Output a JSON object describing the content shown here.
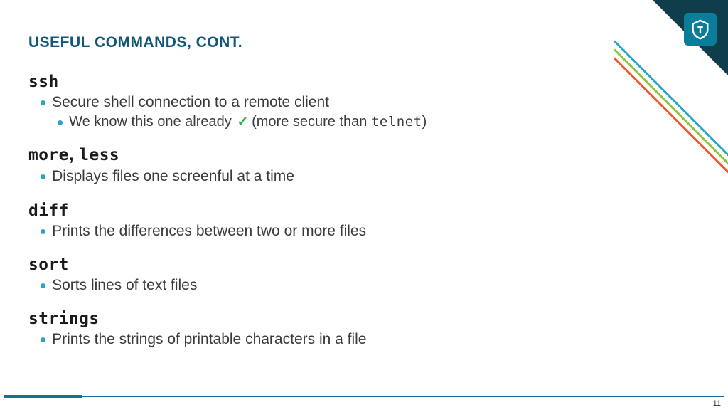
{
  "title": "USEFUL COMMANDS, CONT.",
  "sections": [
    {
      "heading_parts": [
        "ssh"
      ],
      "bullets": [
        {
          "level": 1,
          "text": "Secure shell connection to a remote client"
        },
        {
          "level": 2,
          "prefix": "We know this one already ",
          "check": "✓",
          "mid": "(more secure than ",
          "mono": "telnet",
          "suffix": ")"
        }
      ]
    },
    {
      "heading_parts": [
        "more",
        ", ",
        "less"
      ],
      "bullets": [
        {
          "level": 1,
          "text": "Displays files one screenful at a time"
        }
      ]
    },
    {
      "heading_parts": [
        "diff"
      ],
      "bullets": [
        {
          "level": 1,
          "text": "Prints the differences between two or more files"
        }
      ]
    },
    {
      "heading_parts": [
        "sort"
      ],
      "bullets": [
        {
          "level": 1,
          "text": "Sorts lines of text files"
        }
      ]
    },
    {
      "heading_parts": [
        "strings"
      ],
      "bullets": [
        {
          "level": 1,
          "text": "Prints the strings of printable characters in a file"
        }
      ]
    }
  ],
  "page_number": "11",
  "colors": {
    "title": "#12567a",
    "bullet_dot": "#2aa5c8",
    "check": "#2fb24c",
    "corner_dark": "#0f3d4c",
    "badge": "#0b7d9a",
    "rule": "#13738f"
  }
}
